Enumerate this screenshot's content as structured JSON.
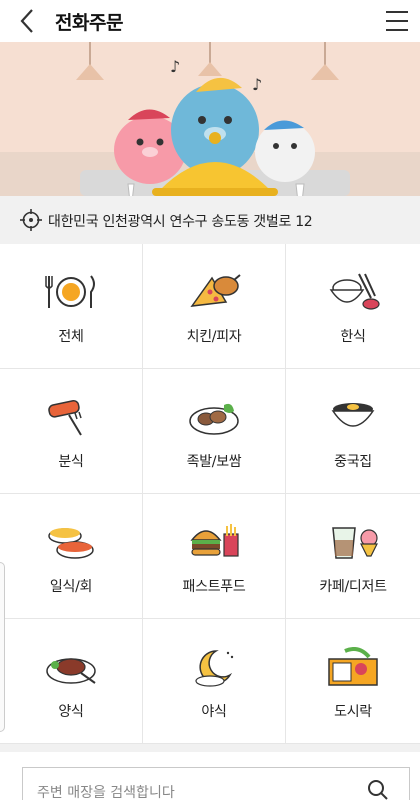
{
  "header": {
    "title": "전화주문",
    "back_icon": "chevron-left-icon",
    "menu_icon": "hamburger-menu-icon"
  },
  "address": {
    "text": "대한민국 인천광역시 연수구 송도동 갯벌로 12",
    "icon": "location-target-icon"
  },
  "categories": [
    {
      "label": "전체",
      "icon": "plate-utensils-icon"
    },
    {
      "label": "치킨/피자",
      "icon": "chicken-pizza-icon"
    },
    {
      "label": "한식",
      "icon": "rice-bowl-icon"
    },
    {
      "label": "분식",
      "icon": "skewer-fork-icon"
    },
    {
      "label": "족발/보쌈",
      "icon": "pork-platter-icon"
    },
    {
      "label": "중국집",
      "icon": "noodle-bowl-icon"
    },
    {
      "label": "일식/회",
      "icon": "sushi-icon"
    },
    {
      "label": "패스트푸드",
      "icon": "burger-fries-icon"
    },
    {
      "label": "카페/디저트",
      "icon": "coffee-dessert-icon"
    },
    {
      "label": "양식",
      "icon": "steak-icon"
    },
    {
      "label": "야식",
      "icon": "moon-night-icon"
    },
    {
      "label": "도시락",
      "icon": "lunchbox-icon"
    }
  ],
  "search": {
    "placeholder": "주변 매장을 검색합니다"
  },
  "colors": {
    "accent": "#f5a623",
    "banner_bg": "#f6dfd2",
    "address_bg": "#f1f1f1"
  }
}
